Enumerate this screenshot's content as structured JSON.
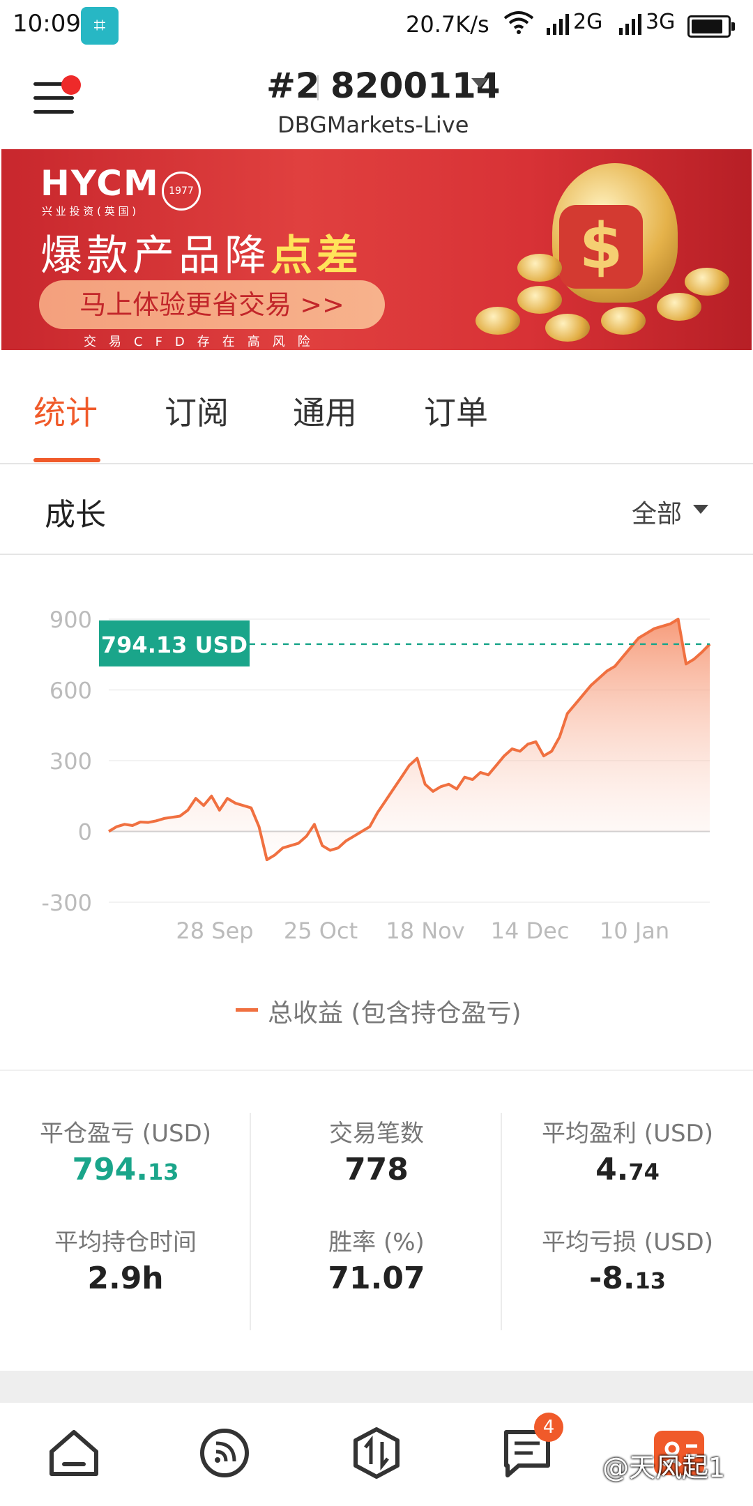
{
  "status_bar": {
    "time": "10:09",
    "net_speed": "20.7K/s",
    "signal_2g": "2G",
    "signal_3g": "3G"
  },
  "header": {
    "account_index": "#2",
    "account_number": "8200114",
    "server": "DBGMarkets-Live"
  },
  "banner": {
    "logo": "HYCM",
    "logo_sub": "兴 业 投 资 ( 英 国 )",
    "seal": "始于1977",
    "headline_main": "爆款产品降",
    "headline_accent": "点差",
    "cta": "马上体验更省交易 >>",
    "risk": "交易CFD存在高风险"
  },
  "tabs": [
    {
      "label": "统计",
      "active": true
    },
    {
      "label": "订阅",
      "active": false
    },
    {
      "label": "通用",
      "active": false
    },
    {
      "label": "订单",
      "active": false
    }
  ],
  "growth": {
    "title": "成长",
    "filter": "全部"
  },
  "chart_data": {
    "type": "area",
    "current_value_label": "794.13 USD",
    "ylim": [
      -300,
      900
    ],
    "yticks": [
      "900",
      "600",
      "300",
      "0",
      "-300"
    ],
    "xticks": [
      "28 Sep",
      "25 Oct",
      "18 Nov",
      "14 Dec",
      "10 Jan"
    ],
    "grid": true,
    "line_color": "#f07040",
    "reference_color": "#1aa58a",
    "series": [
      {
        "name": "总收益 (包含持仓盈亏)",
        "values": [
          0,
          20,
          30,
          25,
          40,
          38,
          45,
          55,
          60,
          65,
          90,
          140,
          110,
          150,
          90,
          140,
          120,
          110,
          100,
          20,
          -120,
          -100,
          -70,
          -60,
          -50,
          -20,
          30,
          -60,
          -80,
          -70,
          -40,
          -20,
          0,
          20,
          80,
          130,
          180,
          230,
          280,
          310,
          200,
          170,
          190,
          200,
          180,
          230,
          220,
          250,
          240,
          280,
          320,
          350,
          340,
          370,
          380,
          320,
          340,
          400,
          500,
          540,
          580,
          620,
          650,
          680,
          700,
          740,
          780,
          820,
          840,
          860,
          870,
          880,
          900,
          710,
          730,
          760,
          794.13
        ]
      }
    ]
  },
  "stats": [
    {
      "label": "平仓盈亏 (USD)",
      "int": "794.",
      "dec": "13",
      "color": "green"
    },
    {
      "label": "交易笔数",
      "int": "778",
      "dec": ""
    },
    {
      "label": "平均盈利 (USD)",
      "int": "4.",
      "dec": "74"
    },
    {
      "label": "平均持仓时间",
      "int": "2.9h",
      "dec": ""
    },
    {
      "label": "胜率 (%)",
      "int": "71.07",
      "dec": ""
    },
    {
      "label": "平均亏损 (USD)",
      "int": "-8.",
      "dec": "13"
    }
  ],
  "bottom_nav": {
    "badge_count": "4",
    "items": [
      "home-icon",
      "feed-icon",
      "trade-icon",
      "messages-icon",
      "profile-icon"
    ]
  },
  "watermark": "@天风起1"
}
